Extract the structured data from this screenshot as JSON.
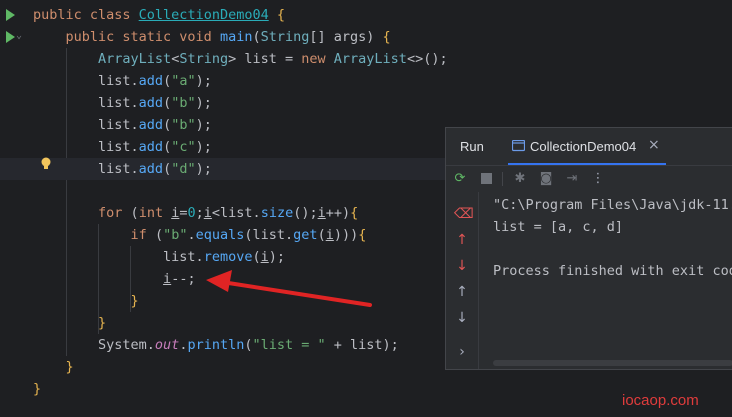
{
  "editor": {
    "lines": [
      {
        "parts": [
          {
            "c": "kw",
            "t": "public class "
          },
          {
            "c": "ul-cls",
            "t": "CollectionDemo04"
          },
          {
            "c": "",
            "t": " "
          },
          {
            "c": "brace",
            "t": "{"
          }
        ]
      },
      {
        "parts": [
          {
            "c": "",
            "t": "    "
          },
          {
            "c": "kw",
            "t": "public static void "
          },
          {
            "c": "fn",
            "t": "main"
          },
          {
            "c": "",
            "t": "("
          },
          {
            "c": "ty",
            "t": "String"
          },
          {
            "c": "",
            "t": "[] args) "
          },
          {
            "c": "brace",
            "t": "{"
          }
        ]
      },
      {
        "parts": [
          {
            "c": "",
            "t": "        "
          },
          {
            "c": "ty",
            "t": "ArrayList"
          },
          {
            "c": "",
            "t": "<"
          },
          {
            "c": "ty",
            "t": "String"
          },
          {
            "c": "",
            "t": "> list = "
          },
          {
            "c": "kw",
            "t": "new "
          },
          {
            "c": "ty",
            "t": "ArrayList"
          },
          {
            "c": "",
            "t": "<>();"
          }
        ]
      },
      {
        "parts": [
          {
            "c": "",
            "t": "        list."
          },
          {
            "c": "fn",
            "t": "add"
          },
          {
            "c": "",
            "t": "("
          },
          {
            "c": "st",
            "t": "\"a\""
          },
          {
            "c": "",
            "t": ");"
          }
        ]
      },
      {
        "parts": [
          {
            "c": "",
            "t": "        list."
          },
          {
            "c": "fn",
            "t": "add"
          },
          {
            "c": "",
            "t": "("
          },
          {
            "c": "st",
            "t": "\"b\""
          },
          {
            "c": "",
            "t": ");"
          }
        ]
      },
      {
        "parts": [
          {
            "c": "",
            "t": "        list."
          },
          {
            "c": "fn",
            "t": "add"
          },
          {
            "c": "",
            "t": "("
          },
          {
            "c": "st",
            "t": "\"b\""
          },
          {
            "c": "",
            "t": ");"
          }
        ]
      },
      {
        "parts": [
          {
            "c": "",
            "t": "        list."
          },
          {
            "c": "fn",
            "t": "add"
          },
          {
            "c": "",
            "t": "("
          },
          {
            "c": "st",
            "t": "\"c\""
          },
          {
            "c": "",
            "t": ");"
          }
        ]
      },
      {
        "parts": [
          {
            "c": "",
            "t": "        list."
          },
          {
            "c": "fn",
            "t": "add"
          },
          {
            "c": "",
            "t": "("
          },
          {
            "c": "st",
            "t": "\"d\""
          },
          {
            "c": "",
            "t": ");"
          }
        ]
      },
      {
        "parts": []
      },
      {
        "parts": [
          {
            "c": "",
            "t": "        "
          },
          {
            "c": "kw",
            "t": "for "
          },
          {
            "c": "",
            "t": "("
          },
          {
            "c": "kw",
            "t": "int "
          },
          {
            "c": "ul",
            "t": "i"
          },
          {
            "c": "",
            "t": "="
          },
          {
            "c": "nm",
            "t": "0"
          },
          {
            "c": "",
            "t": ";"
          },
          {
            "c": "ul",
            "t": "i"
          },
          {
            "c": "",
            "t": "<list."
          },
          {
            "c": "fn",
            "t": "size"
          },
          {
            "c": "",
            "t": "();"
          },
          {
            "c": "ul",
            "t": "i"
          },
          {
            "c": "",
            "t": "++)"
          },
          {
            "c": "brace",
            "t": "{"
          }
        ]
      },
      {
        "parts": [
          {
            "c": "",
            "t": "            "
          },
          {
            "c": "kw",
            "t": "if "
          },
          {
            "c": "",
            "t": "("
          },
          {
            "c": "st",
            "t": "\"b\""
          },
          {
            "c": "",
            "t": "."
          },
          {
            "c": "fn",
            "t": "equals"
          },
          {
            "c": "",
            "t": "(list."
          },
          {
            "c": "fn",
            "t": "get"
          },
          {
            "c": "",
            "t": "("
          },
          {
            "c": "ul",
            "t": "i"
          },
          {
            "c": "",
            "t": ")))"
          },
          {
            "c": "brace",
            "t": "{"
          }
        ]
      },
      {
        "parts": [
          {
            "c": "",
            "t": "                list."
          },
          {
            "c": "fn",
            "t": "remove"
          },
          {
            "c": "",
            "t": "("
          },
          {
            "c": "ul",
            "t": "i"
          },
          {
            "c": "",
            "t": ");"
          }
        ]
      },
      {
        "parts": [
          {
            "c": "",
            "t": "                "
          },
          {
            "c": "ul",
            "t": "i"
          },
          {
            "c": "",
            "t": "--;"
          }
        ]
      },
      {
        "parts": [
          {
            "c": "",
            "t": "            "
          },
          {
            "c": "brace",
            "t": "}"
          }
        ]
      },
      {
        "parts": [
          {
            "c": "",
            "t": "        "
          },
          {
            "c": "brace",
            "t": "}"
          }
        ]
      },
      {
        "parts": [
          {
            "c": "",
            "t": "        System."
          },
          {
            "c": "it",
            "t": "out"
          },
          {
            "c": "",
            "t": "."
          },
          {
            "c": "fn",
            "t": "println"
          },
          {
            "c": "",
            "t": "("
          },
          {
            "c": "st",
            "t": "\"list = \""
          },
          {
            "c": "",
            "t": " + list);"
          }
        ]
      },
      {
        "parts": [
          {
            "c": "",
            "t": "    "
          },
          {
            "c": "brace",
            "t": "}"
          }
        ]
      },
      {
        "parts": [
          {
            "c": "brace",
            "t": "}"
          }
        ]
      }
    ]
  },
  "run_panel": {
    "title": "Run",
    "tab_label": "CollectionDemo04",
    "tab_close": "×",
    "output": [
      "\"C:\\Program Files\\Java\\jdk-11.",
      "list = [a, c, d]",
      "",
      "Process finished with exit cod"
    ]
  },
  "watermark": "iocaop.com",
  "colors": {
    "arrow": "#e02424",
    "accent": "#3574f0"
  }
}
